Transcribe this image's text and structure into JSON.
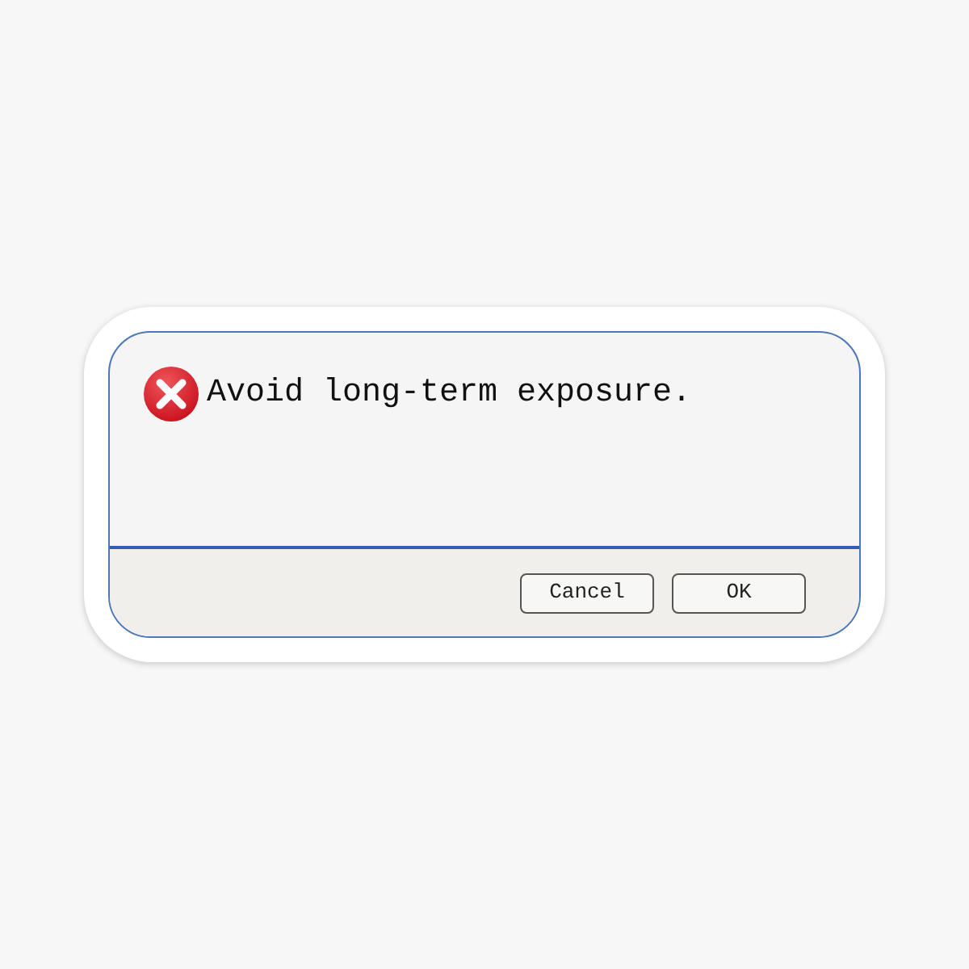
{
  "dialog": {
    "message": "Avoid long-term exposure.",
    "kind": "error",
    "buttons": [
      {
        "label": "Cancel"
      },
      {
        "label": "OK"
      }
    ]
  }
}
